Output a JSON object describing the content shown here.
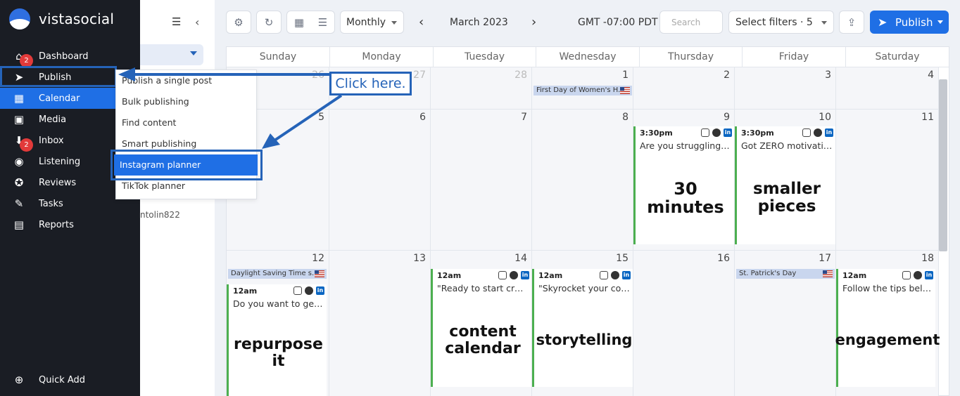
{
  "brand": {
    "name": "vistasocial"
  },
  "nav": {
    "items": [
      {
        "label": "Dashboard",
        "icon": "home-icon",
        "badge": "2"
      },
      {
        "label": "Publish",
        "icon": "paper-plane-icon"
      },
      {
        "label": "Calendar",
        "icon": "calendar-icon"
      },
      {
        "label": "Media",
        "icon": "image-icon"
      },
      {
        "label": "Inbox",
        "icon": "inbox-icon",
        "badge": "2"
      },
      {
        "label": "Listening",
        "icon": "listening-icon"
      },
      {
        "label": "Reviews",
        "icon": "star-icon"
      },
      {
        "label": "Tasks",
        "icon": "pin-icon"
      },
      {
        "label": "Reports",
        "icon": "report-icon"
      }
    ],
    "quick_add": "Quick Add"
  },
  "panel": {
    "user": "ntolin822"
  },
  "menu": {
    "items": [
      "Publish a single post",
      "Bulk publishing",
      "Find content",
      "Smart publishing",
      "Instagram planner",
      "TikTok planner"
    ],
    "selected": "Instagram planner"
  },
  "callout": {
    "text": "Click here."
  },
  "toolbar": {
    "view": "Monthly",
    "month": "March 2023",
    "timezone": "GMT -07:00 PDT",
    "search_placeholder": "Search",
    "filters": "Select filters · 5",
    "publish": "Publish"
  },
  "calendar": {
    "days": [
      "Sunday",
      "Monday",
      "Tuesday",
      "Wednesday",
      "Thursday",
      "Friday",
      "Saturday"
    ],
    "week1": [
      "26",
      "27",
      "28",
      "1",
      "2",
      "3",
      "4"
    ],
    "week2": [
      "5",
      "6",
      "7",
      "8",
      "9",
      "10",
      "11"
    ],
    "week3": [
      "12",
      "13",
      "14",
      "15",
      "16",
      "17",
      "18"
    ],
    "holidays": {
      "h1": "First Day of Women's H...",
      "h2": "Daylight Saving Time s...",
      "h3": "St. Patrick's Day"
    },
    "posts": {
      "p9": {
        "time": "3:30pm",
        "caption": "Are you struggling to...",
        "art": "30 minutes"
      },
      "p10": {
        "time": "3:30pm",
        "caption": "Got ZERO motivation ...",
        "art": "smaller pieces"
      },
      "p12": {
        "time": "12am",
        "caption": "Do you want to get ...",
        "art": "repurpose it"
      },
      "p14": {
        "time": "12am",
        "caption": "\"Ready to start creati...",
        "art": "content calendar"
      },
      "p15": {
        "time": "12am",
        "caption": "\"Skyrocket your cont...",
        "art": "storytelling"
      },
      "p18": {
        "time": "12am",
        "caption": "Follow the tips below ...",
        "art": "engagement"
      }
    }
  },
  "colors": {
    "accent": "#1f6fe5",
    "nav_bg": "#1a1d24",
    "annotation": "#2563b8",
    "post_border": "#4caf50"
  }
}
